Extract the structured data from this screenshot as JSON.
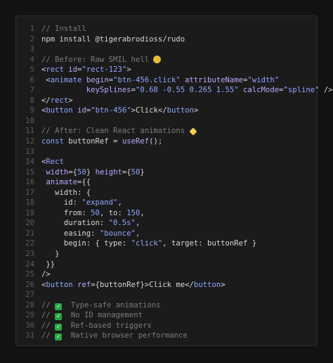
{
  "editor": {
    "lines": [
      {
        "n": "1",
        "tokens": [
          {
            "t": "// Install",
            "c": "cm"
          }
        ]
      },
      {
        "n": "2",
        "tokens": [
          {
            "t": "npm install @tigerabrodioss/rudo",
            "c": "pl"
          }
        ]
      },
      {
        "n": "3",
        "tokens": []
      },
      {
        "n": "4",
        "tokens": [
          {
            "t": "// Before: Raw SMIL hell ",
            "c": "cm"
          },
          {
            "e": "yellow"
          }
        ]
      },
      {
        "n": "5",
        "tokens": [
          {
            "t": "<",
            "c": "pl"
          },
          {
            "t": "rect",
            "c": "tg"
          },
          {
            "t": " ",
            "c": "pl"
          },
          {
            "t": "id",
            "c": "at"
          },
          {
            "t": "=",
            "c": "pl"
          },
          {
            "t": "\"rect-123\"",
            "c": "st"
          },
          {
            "t": ">",
            "c": "pl"
          }
        ]
      },
      {
        "n": "6",
        "tokens": [
          {
            "t": " <",
            "c": "pl"
          },
          {
            "t": "animate",
            "c": "tg"
          },
          {
            "t": " ",
            "c": "pl"
          },
          {
            "t": "begin",
            "c": "at"
          },
          {
            "t": "=",
            "c": "pl"
          },
          {
            "t": "\"btn-456.click\"",
            "c": "st"
          },
          {
            "t": " ",
            "c": "pl"
          },
          {
            "t": "attributeName",
            "c": "at"
          },
          {
            "t": "=",
            "c": "pl"
          },
          {
            "t": "\"width\"",
            "c": "st"
          }
        ]
      },
      {
        "n": "7",
        "tokens": [
          {
            "t": "          ",
            "c": "pl"
          },
          {
            "t": "keySplines",
            "c": "at"
          },
          {
            "t": "=",
            "c": "pl"
          },
          {
            "t": "\"0.68 -0.55 0.265 1.55\"",
            "c": "st"
          },
          {
            "t": " ",
            "c": "pl"
          },
          {
            "t": "calcMode",
            "c": "at"
          },
          {
            "t": "=",
            "c": "pl"
          },
          {
            "t": "\"spline\"",
            "c": "st"
          },
          {
            "t": " />",
            "c": "pl"
          }
        ]
      },
      {
        "n": "8",
        "tokens": [
          {
            "t": "</",
            "c": "pl"
          },
          {
            "t": "rect",
            "c": "tg"
          },
          {
            "t": ">",
            "c": "pl"
          }
        ]
      },
      {
        "n": "9",
        "tokens": [
          {
            "t": "<",
            "c": "pl"
          },
          {
            "t": "button",
            "c": "tg"
          },
          {
            "t": " ",
            "c": "pl"
          },
          {
            "t": "id",
            "c": "at"
          },
          {
            "t": "=",
            "c": "pl"
          },
          {
            "t": "\"btn-456\"",
            "c": "st"
          },
          {
            "t": ">Click</",
            "c": "pl"
          },
          {
            "t": "button",
            "c": "tg"
          },
          {
            "t": ">",
            "c": "pl"
          }
        ]
      },
      {
        "n": "10",
        "tokens": []
      },
      {
        "n": "11",
        "tokens": [
          {
            "t": "// After: Clean React animations ",
            "c": "cm"
          },
          {
            "e": "spark"
          }
        ]
      },
      {
        "n": "12",
        "tokens": [
          {
            "t": "const",
            "c": "kw"
          },
          {
            "t": " buttonRef = ",
            "c": "pl"
          },
          {
            "t": "useRef",
            "c": "at"
          },
          {
            "t": "();",
            "c": "pl"
          }
        ]
      },
      {
        "n": "13",
        "tokens": []
      },
      {
        "n": "14",
        "tokens": [
          {
            "t": "<",
            "c": "pl"
          },
          {
            "t": "Rect",
            "c": "tg"
          }
        ]
      },
      {
        "n": "15",
        "tokens": [
          {
            "t": " ",
            "c": "pl"
          },
          {
            "t": "width",
            "c": "at"
          },
          {
            "t": "={",
            "c": "pl"
          },
          {
            "t": "50",
            "c": "nm"
          },
          {
            "t": "} ",
            "c": "pl"
          },
          {
            "t": "height",
            "c": "at"
          },
          {
            "t": "={",
            "c": "pl"
          },
          {
            "t": "50",
            "c": "nm"
          },
          {
            "t": "}",
            "c": "pl"
          }
        ]
      },
      {
        "n": "16",
        "tokens": [
          {
            "t": " ",
            "c": "pl"
          },
          {
            "t": "animate",
            "c": "at"
          },
          {
            "t": "={{",
            "c": "pl"
          }
        ]
      },
      {
        "n": "17",
        "tokens": [
          {
            "t": "   width: {",
            "c": "pl"
          }
        ]
      },
      {
        "n": "18",
        "tokens": [
          {
            "t": "     id: ",
            "c": "pl"
          },
          {
            "t": "\"expand\"",
            "c": "st"
          },
          {
            "t": ",",
            "c": "pl"
          }
        ]
      },
      {
        "n": "19",
        "tokens": [
          {
            "t": "     from: ",
            "c": "pl"
          },
          {
            "t": "50",
            "c": "nm"
          },
          {
            "t": ", to: ",
            "c": "pl"
          },
          {
            "t": "150",
            "c": "nm"
          },
          {
            "t": ",",
            "c": "pl"
          }
        ]
      },
      {
        "n": "20",
        "tokens": [
          {
            "t": "     duration: ",
            "c": "pl"
          },
          {
            "t": "\"0.5s\"",
            "c": "st"
          },
          {
            "t": ",",
            "c": "pl"
          }
        ]
      },
      {
        "n": "21",
        "tokens": [
          {
            "t": "     easing: ",
            "c": "pl"
          },
          {
            "t": "\"bounce\"",
            "c": "st"
          },
          {
            "t": ",",
            "c": "pl"
          }
        ]
      },
      {
        "n": "22",
        "tokens": [
          {
            "t": "     begin: { type: ",
            "c": "pl"
          },
          {
            "t": "\"click\"",
            "c": "st"
          },
          {
            "t": ", target: buttonRef }",
            "c": "pl"
          }
        ]
      },
      {
        "n": "23",
        "tokens": [
          {
            "t": "   }",
            "c": "pl"
          }
        ]
      },
      {
        "n": "24",
        "tokens": [
          {
            "t": " }}",
            "c": "pl"
          }
        ]
      },
      {
        "n": "25",
        "tokens": [
          {
            "t": "/>",
            "c": "pl"
          }
        ]
      },
      {
        "n": "26",
        "tokens": [
          {
            "t": "<",
            "c": "pl"
          },
          {
            "t": "button",
            "c": "tg"
          },
          {
            "t": " ",
            "c": "pl"
          },
          {
            "t": "ref",
            "c": "at"
          },
          {
            "t": "={buttonRef}>Click me</",
            "c": "pl"
          },
          {
            "t": "button",
            "c": "tg"
          },
          {
            "t": ">",
            "c": "pl"
          }
        ]
      },
      {
        "n": "27",
        "tokens": []
      },
      {
        "n": "28",
        "tokens": [
          {
            "t": "// ",
            "c": "cm"
          },
          {
            "k": true
          },
          {
            "t": "  Type-safe animations",
            "c": "cm"
          }
        ]
      },
      {
        "n": "29",
        "tokens": [
          {
            "t": "// ",
            "c": "cm"
          },
          {
            "k": true
          },
          {
            "t": "  No ID management",
            "c": "cm"
          }
        ]
      },
      {
        "n": "30",
        "tokens": [
          {
            "t": "// ",
            "c": "cm"
          },
          {
            "k": true
          },
          {
            "t": "  Ref-based triggers",
            "c": "cm"
          }
        ]
      },
      {
        "n": "31",
        "tokens": [
          {
            "t": "// ",
            "c": "cm"
          },
          {
            "k": true
          },
          {
            "t": "  Native browser performance",
            "c": "cm"
          }
        ]
      }
    ]
  },
  "icons": {
    "emoji-yellow": "smiling-face-icon",
    "emoji-spark": "sparkles-icon",
    "check": "check-mark-icon"
  },
  "colors": {
    "background": "#121212",
    "panel": "#1b1b1b",
    "comment": "#7b7b7b",
    "tag": "#8ea6ff",
    "attribute": "#b9a8ff",
    "check": "#27a844"
  }
}
